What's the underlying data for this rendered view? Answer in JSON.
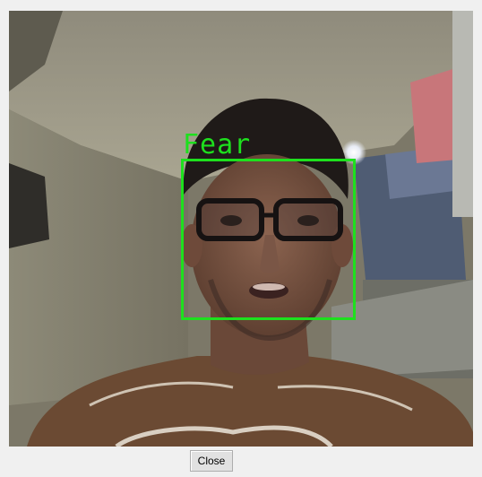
{
  "detection": {
    "emotion_label": "Fear",
    "box_color": "#1ee01e"
  },
  "footer": {
    "close_label": "Close"
  }
}
